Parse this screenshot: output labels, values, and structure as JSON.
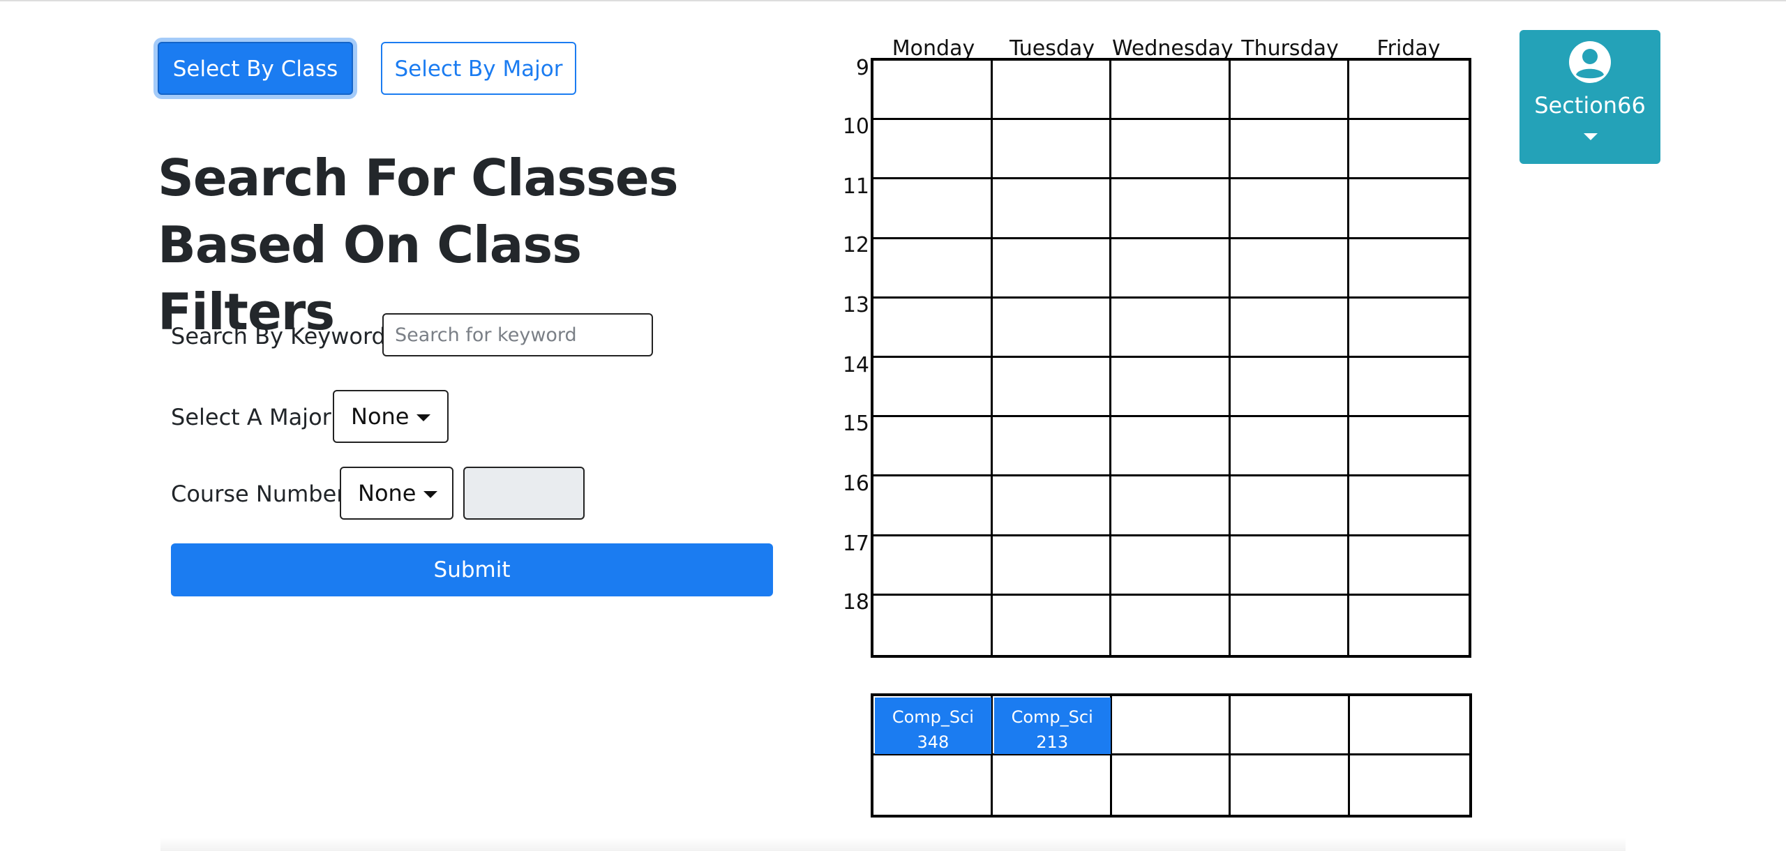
{
  "mode_buttons": {
    "select_by_class": "Select By Class",
    "select_by_major": "Select By Major"
  },
  "page_title": "Search For Classes Based On Class Filters",
  "form": {
    "keyword_label": "Search By Keyword:",
    "keyword_placeholder": "Search for keyword",
    "keyword_value": "",
    "major_label": "Select A Major:",
    "major_selected": "None",
    "course_number_label": "Course Number",
    "course_number_selected": "None",
    "course_number_value": "",
    "submit_label": "Submit"
  },
  "schedule": {
    "days": [
      "Monday",
      "Tuesday",
      "Wednesday",
      "Thursday",
      "Friday"
    ],
    "hours": [
      "9",
      "10",
      "11",
      "12",
      "13",
      "14",
      "15",
      "16",
      "17",
      "18"
    ]
  },
  "unscheduled": {
    "columns": 5,
    "rows": 2,
    "courses": [
      {
        "dept": "Comp_Sci",
        "number": "348",
        "slot": 0
      },
      {
        "dept": "Comp_Sci",
        "number": "213",
        "slot": 1
      }
    ]
  },
  "user": {
    "name": "Section66",
    "icon": "user-circle-icon"
  },
  "colors": {
    "primary": "#1b7cf1",
    "user_card": "#24a2b8",
    "disabled_input": "#e9ecef"
  }
}
